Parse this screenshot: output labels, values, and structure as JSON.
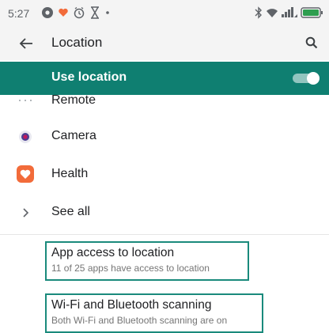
{
  "status_bar": {
    "time": "5:27",
    "left_icons": [
      "settings-notification-icon",
      "heart-notification-icon",
      "alarm-icon",
      "hourglass-icon",
      "dot-icon"
    ],
    "right_icons": [
      "bluetooth-icon",
      "wifi-icon",
      "signal-icon",
      "battery-icon"
    ],
    "battery_color": "#2e9e4f"
  },
  "app_bar": {
    "title": "Location",
    "back_icon": "arrow-back-icon",
    "search_icon": "search-icon"
  },
  "use_location": {
    "label": "Use location",
    "enabled": true,
    "background_color": "#0f7f71"
  },
  "recent_apps": [
    {
      "label": "Remote",
      "icon": "remote-icon"
    },
    {
      "label": "Camera",
      "icon": "camera-icon"
    },
    {
      "label": "Health",
      "icon": "health-icon",
      "icon_color": "#f26b3a"
    }
  ],
  "see_all": {
    "label": "See all",
    "icon": "chevron-right-icon"
  },
  "settings": [
    {
      "title": "App access to location",
      "subtitle": "11 of 25 apps have access to location"
    },
    {
      "title": "Wi-Fi and Bluetooth scanning",
      "subtitle": "Both Wi-Fi and Bluetooth scanning are on"
    }
  ],
  "highlight_color": "#1a8a7c"
}
